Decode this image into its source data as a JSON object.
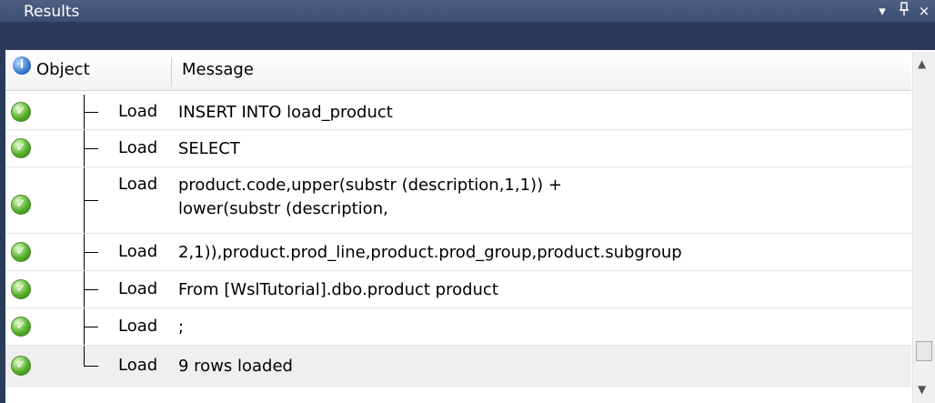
{
  "panel": {
    "title": "Results",
    "dropdown_icon": "chevron-down-icon",
    "pin_icon": "pin-icon",
    "close_icon": "close-icon",
    "dropdown_glyph": "▾",
    "pin_glyph": "ꟸ",
    "close_glyph": "×"
  },
  "columns": {
    "status_icon": "info-icon",
    "status_glyph": "i",
    "object": "Object",
    "message": "Message"
  },
  "rows": [
    {
      "status": "success",
      "object": "Load",
      "message": "INSERT INTO load_product"
    },
    {
      "status": "success",
      "object": "Load",
      "message": "SELECT"
    },
    {
      "status": "success",
      "object": "Load",
      "message": "product.code,upper(substr  (description,1,1)) +",
      "message2": "lower(substr (description,"
    },
    {
      "status": "success",
      "object": "Load",
      "message": "2,1)),product.prod_line,product.prod_group,product.subgroup"
    },
    {
      "status": "success",
      "object": "Load",
      "message": "From [WslTutorial].dbo.product product"
    },
    {
      "status": "success",
      "object": "Load",
      "message": ";"
    },
    {
      "status": "success",
      "object": "Load",
      "message": "9 rows loaded"
    }
  ],
  "colors": {
    "title_bar": "#3b4e70",
    "success": "#58b12b",
    "selected_row": "#efefef"
  },
  "scrollbar": {
    "up_glyph": "▲",
    "down_glyph": "▼"
  }
}
